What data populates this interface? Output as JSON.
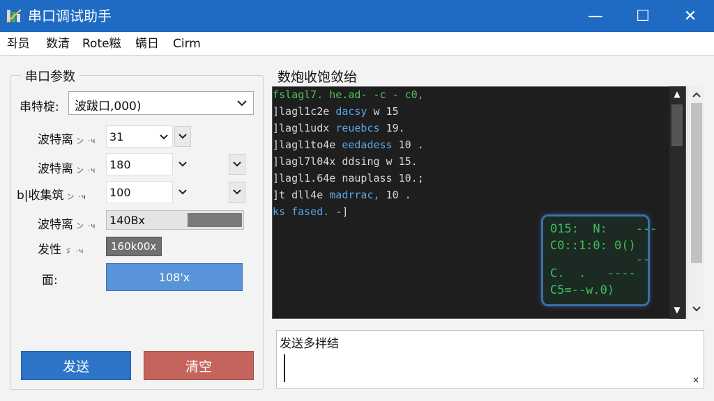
{
  "window": {
    "title": "串口调试助手",
    "controls": {
      "minimize": "—",
      "maximize": "☐",
      "close": "✕"
    }
  },
  "menu": [
    "좌员",
    "数清",
    "Rote糍",
    "螨日",
    "Cirm"
  ],
  "serial_params": {
    "legend": "串口参数",
    "port": {
      "label": "串特椗:",
      "value": "波跋口,000)"
    },
    "rows": [
      {
        "label": "波特离",
        "sub": "ン ·ч",
        "value": "31"
      },
      {
        "label": "波特离",
        "sub": "ン ·ч",
        "value": "180"
      },
      {
        "label": "b|收集筑",
        "sub": "ン ·ч",
        "value": "100"
      },
      {
        "label": "波特离",
        "sub": "ン ·ч",
        "value": "140Bx"
      },
      {
        "label": "发性",
        "sub": "ゞ ·ч",
        "value": "160k00x"
      },
      {
        "label": "面:",
        "value": "108'x"
      }
    ]
  },
  "buttons": {
    "send": "发送",
    "clear": "清空"
  },
  "receive": {
    "title": "数炮收饱敛绐",
    "lines": [
      {
        "prefix": "fslagl7. ",
        "rest": "he.ad- ",
        "tail": "-c - c0,",
        "color_main": "#52c45a",
        "color_mid": "#52c45a"
      },
      {
        "prefix": "]lagl1c2e ",
        "rest": "dacsy",
        "tail": " w 15",
        "color_main": "#d8d8d8",
        "color_mid": "#5aa6e8"
      },
      {
        "prefix": "]lagl1udx ",
        "rest": "reuebcs",
        "tail": " 19.",
        "color_main": "#d8d8d8",
        "color_mid": "#5aa6e8"
      },
      {
        "prefix": "]lagl1to4e ",
        "rest": "eedadess",
        "tail": " 10 .",
        "color_main": "#d8d8d8",
        "color_mid": "#5aa6e8"
      },
      {
        "prefix": "]lagl7l04x ",
        "rest": "ddsing",
        "tail": " w 15.",
        "color_main": "#d8d8d8",
        "color_mid": "#d8d8d8"
      },
      {
        "prefix": "]lagl1.64e ",
        "rest": "naupl",
        "tail": "ass 10.;",
        "color_main": "#d8d8d8",
        "color_mid": "#d8d8d8"
      },
      {
        "prefix": "]t dll4e ",
        "rest": "madrrac,",
        "tail": " 10 .",
        "color_main": "#d8d8d8",
        "color_mid": "#5aa6e8"
      },
      {
        "prefix": "ks fased. ",
        "rest": "-]",
        "tail": "",
        "color_main": "#5aa6e8",
        "color_mid": "#d8d8d8"
      }
    ],
    "mini": [
      "015:  N:    ---",
      "C0::1:0: 0()",
      "            -- ",
      "C.  .   ----",
      "C5=--w.0)"
    ]
  },
  "send_area": {
    "label": "发送多拌结",
    "value": ""
  }
}
